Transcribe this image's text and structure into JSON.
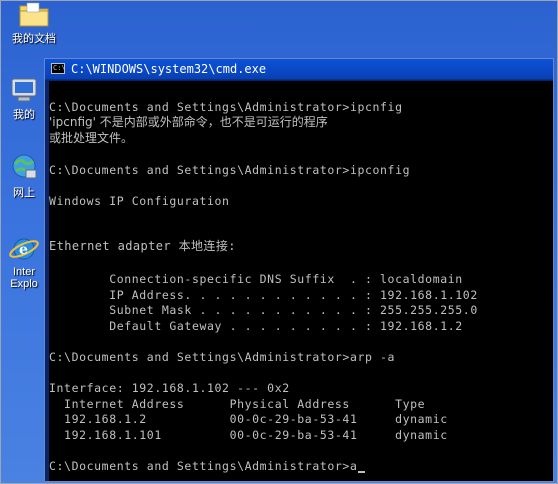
{
  "desktop": {
    "icons": [
      {
        "label": "我的文档",
        "icon": "folder-icon"
      },
      {
        "label": "我的",
        "icon": "my-computer-icon"
      },
      {
        "label": "网上",
        "icon": "network-icon"
      },
      {
        "label": "Inter",
        "label2": "Explo",
        "icon": "internet-explorer-icon"
      }
    ]
  },
  "window": {
    "title": "C:\\WINDOWS\\system32\\cmd.exe",
    "icon": "cmd-icon"
  },
  "console": {
    "lines": [
      "C:\\Documents and Settings\\Administrator>ipcnfig",
      "'ipcnfig' 不是内部或外部命令，也不是可运行的程序",
      "或批处理文件。",
      "C:\\Documents and Settings\\Administrator>ipconfig",
      "Windows IP Configuration",
      "Ethernet adapter 本地连接:",
      "        Connection-specific DNS Suffix  . : localdomain",
      "        IP Address. . . . . . . . . . . . : 192.168.1.102",
      "        Subnet Mask . . . . . . . . . . . : 255.255.255.0",
      "        Default Gateway . . . . . . . . . : 192.168.1.2",
      "C:\\Documents and Settings\\Administrator>arp -a",
      "Interface: 192.168.1.102 --- 0x2",
      "  Internet Address      Physical Address      Type",
      "  192.168.1.2           00-0c-29-ba-53-41     dynamic",
      "  192.168.1.101         00-0c-29-ba-53-41     dynamic",
      "C:\\Documents and Settings\\Administrator>a"
    ]
  },
  "colors": {
    "console_bg": "#000000",
    "console_text": "#c0c0c0",
    "titlebar": "#0a49c7",
    "desktop": "#3a73de"
  }
}
